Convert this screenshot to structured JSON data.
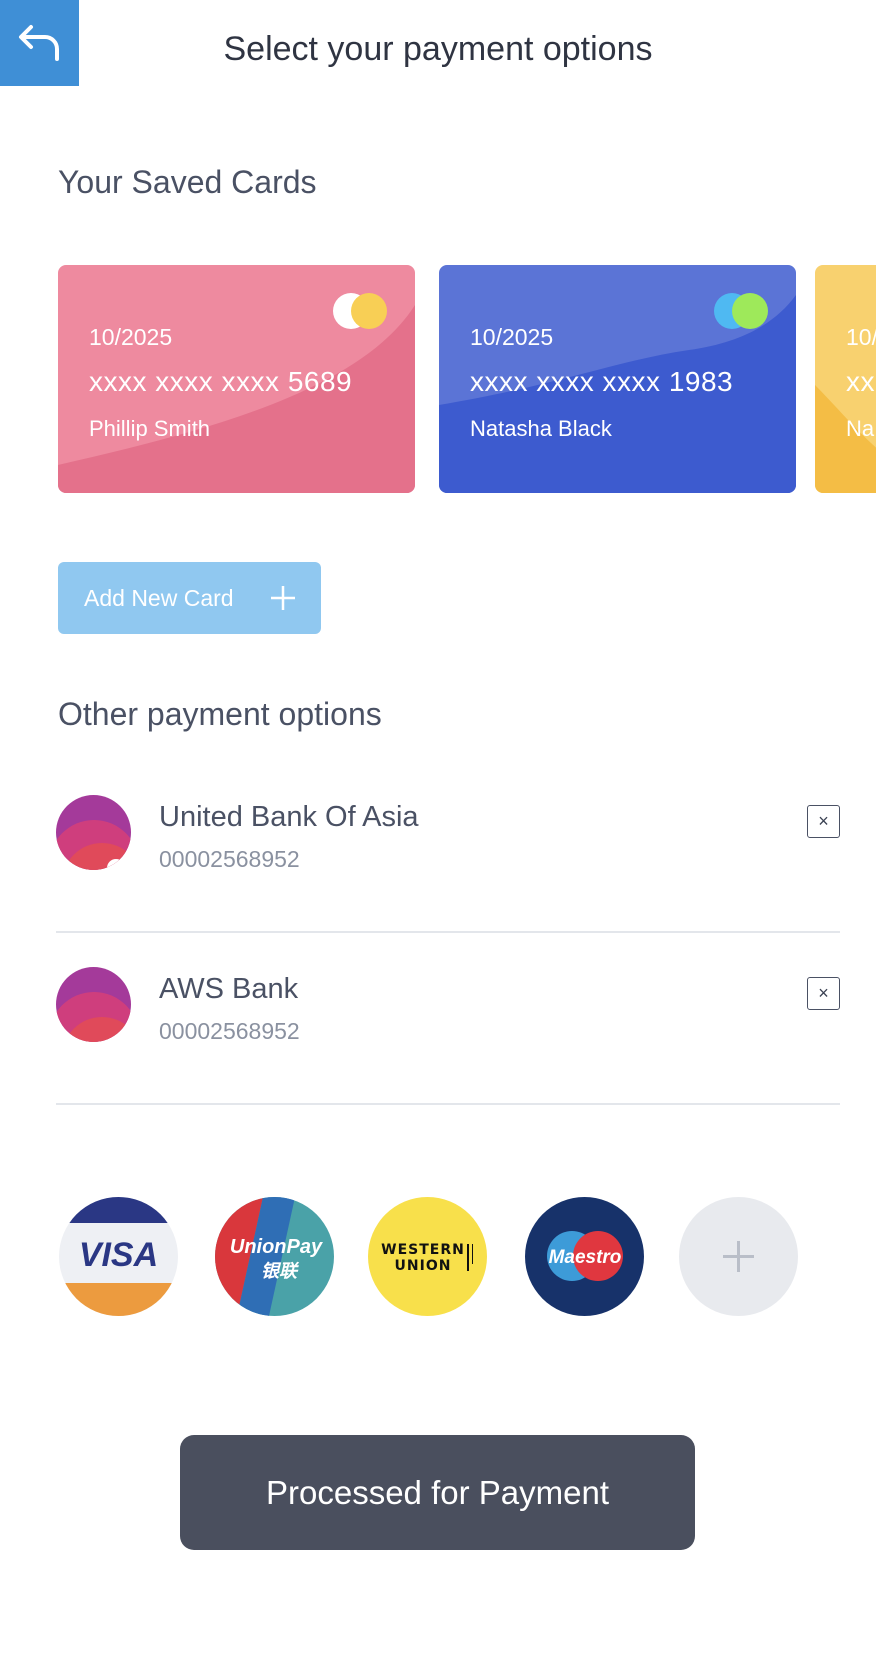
{
  "header": {
    "title": "Select your payment options",
    "back_icon": "back-arrow-icon"
  },
  "saved_cards": {
    "title": "Your Saved Cards",
    "cards": [
      {
        "expiry": "10/2025",
        "number": "xxxx xxxx xxxx 5689",
        "holder": "Phillip Smith",
        "color": "#e8758f"
      },
      {
        "expiry": "10/2025",
        "number": "xxxx xxxx xxxx 1983",
        "holder": "Natasha Black",
        "color": "#3f5dd1"
      },
      {
        "expiry": "10/",
        "number": "xx",
        "holder": "Na",
        "color": "#f4bd45"
      }
    ],
    "add_button": "Add New Card"
  },
  "other_options": {
    "title": "Other payment options",
    "items": [
      {
        "name": "United Bank Of Asia",
        "account": "00002568952",
        "remove_label": "×"
      },
      {
        "name": "AWS Bank",
        "account": "00002568952",
        "remove_label": "×"
      }
    ]
  },
  "providers": [
    {
      "name": "VISA",
      "icon": "visa-icon"
    },
    {
      "name": "UnionPay",
      "sub": "银联",
      "icon": "unionpay-icon"
    },
    {
      "name": "WESTERN",
      "sub": "UNION",
      "icon": "western-union-icon"
    },
    {
      "name": "Maestro",
      "icon": "maestro-icon"
    },
    {
      "name": "",
      "icon": "add-provider-icon"
    }
  ],
  "footer": {
    "submit_label": "Processed for Payment"
  },
  "colors": {
    "accent": "#3f8fd6",
    "submit": "#4a4f5e",
    "add_card": "#90c8f0"
  }
}
